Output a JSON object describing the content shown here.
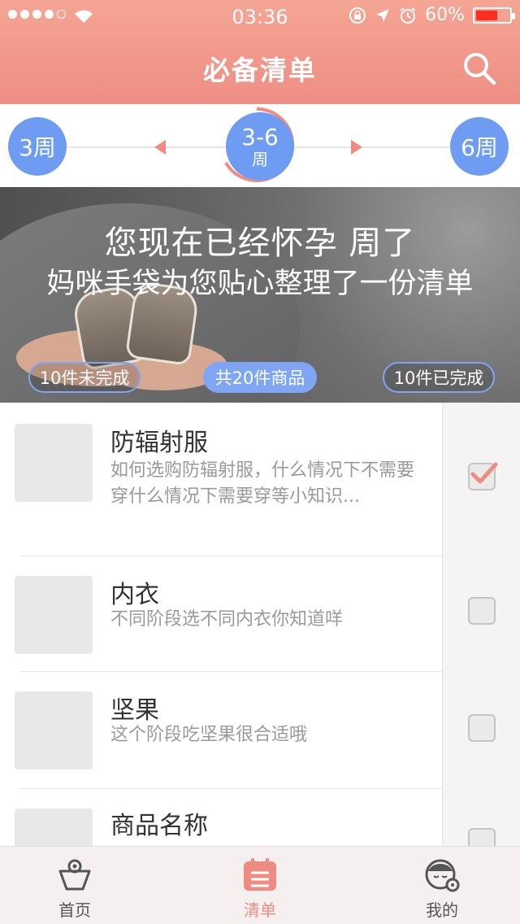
{
  "status_bar": {
    "time": "03:36",
    "battery": "60%",
    "battery_level": 0.6
  },
  "header": {
    "title": "必备清单",
    "search_icon": "search-icon"
  },
  "week_selector": {
    "prev": "3周",
    "current_main": "3-6",
    "current_sub": "周",
    "next": "6周",
    "accent": "#6e9cf3",
    "arrow_color": "#f08b80"
  },
  "banner": {
    "line1": "您现在已经怀孕    周了",
    "line2": "妈咪手袋为您贴心整理了一份清单",
    "uncompleted": "10件未完成",
    "total": "共20件商品",
    "completed": "10件已完成"
  },
  "items": [
    {
      "name": "防辐射服",
      "desc": "如何选购防辐射服，什么情况下不需要穿什么情况下需要穿等小知识...",
      "checked": true
    },
    {
      "name": "内衣",
      "desc": "不同阶段选不同内衣你知道咩",
      "checked": false
    },
    {
      "name": "坚果",
      "desc": "这个阶段吃坚果很合适哦",
      "checked": false
    },
    {
      "name": "商品名称",
      "desc": "",
      "checked": false
    }
  ],
  "tabs": [
    {
      "label": "首页",
      "icon": "home-bag-icon",
      "active": false
    },
    {
      "label": "清单",
      "icon": "list-icon",
      "active": true
    },
    {
      "label": "我的",
      "icon": "profile-icon",
      "active": false
    }
  ],
  "colors": {
    "header": "#f29a8c",
    "tab_active": "#f08b80",
    "badge_blue": "#7ea6f4"
  }
}
